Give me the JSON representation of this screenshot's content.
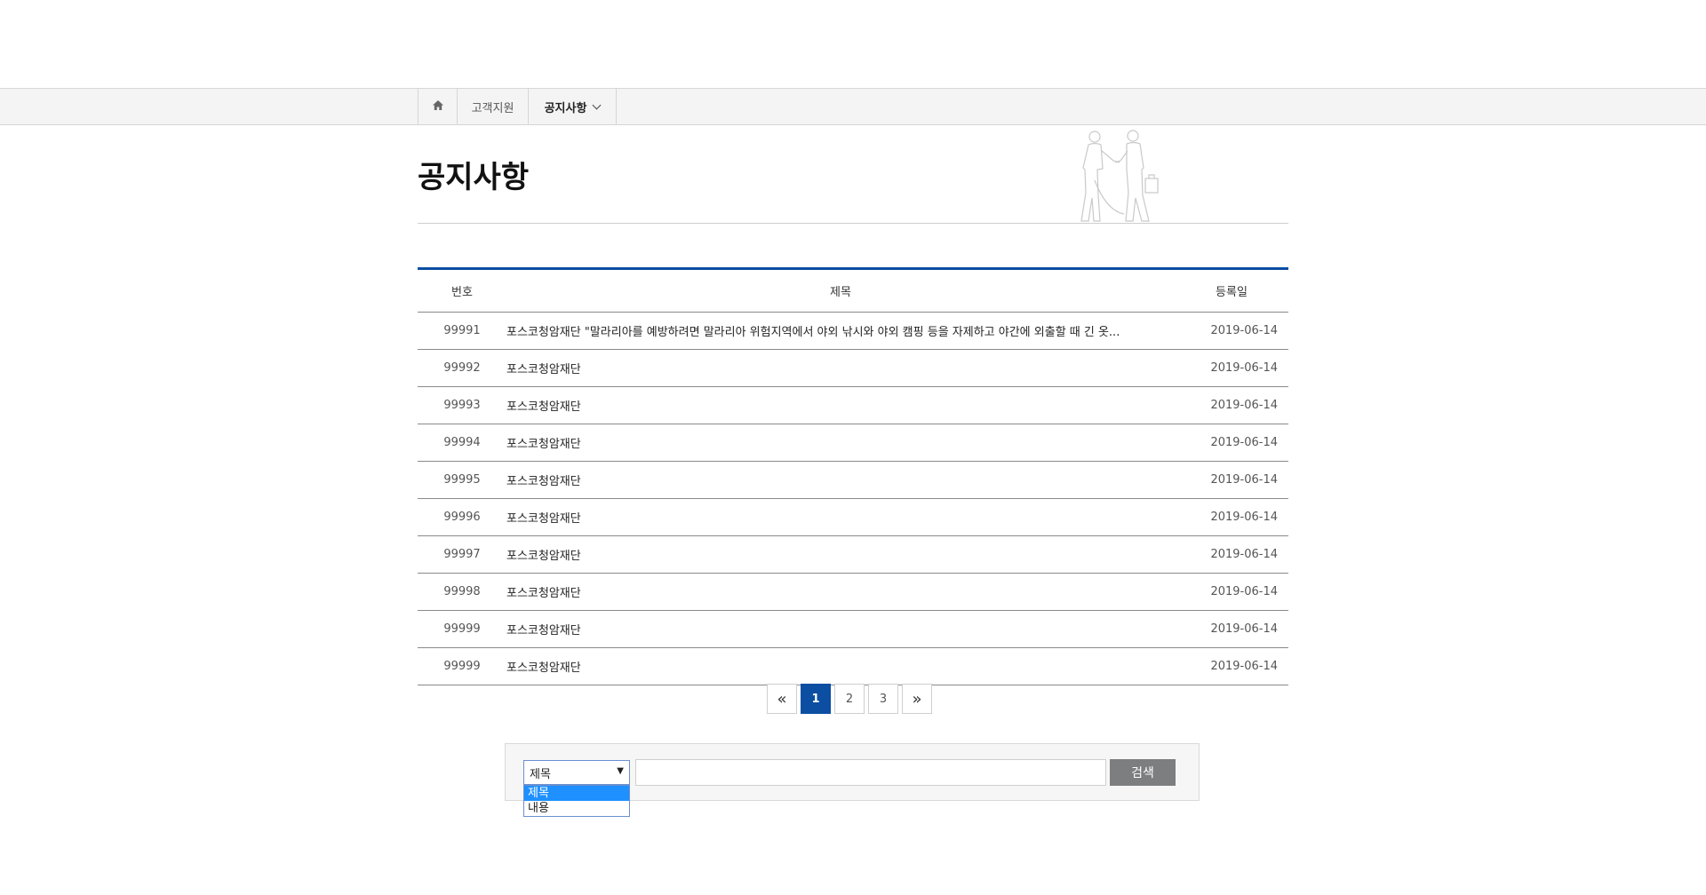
{
  "breadcrumb": {
    "home_icon": "home-icon",
    "items": [
      "고객지원",
      "공지사항"
    ]
  },
  "page": {
    "title": "공지사항"
  },
  "table": {
    "headers": {
      "number": "번호",
      "title": "제목",
      "date": "등록일"
    },
    "rows": [
      {
        "number": "99991",
        "title": "포스코청암재단 \"말라리아를 예방하려면 말라리아 위험지역에서 야외 낚시와 야외 캠핑 등을 자제하고 야간에 외출할 때 긴 옷...",
        "date": "2019-06-14"
      },
      {
        "number": "99992",
        "title": "포스코청암재단",
        "date": "2019-06-14"
      },
      {
        "number": "99993",
        "title": "포스코청암재단",
        "date": "2019-06-14"
      },
      {
        "number": "99994",
        "title": "포스코청암재단",
        "date": "2019-06-14"
      },
      {
        "number": "99995",
        "title": "포스코청암재단",
        "date": "2019-06-14"
      },
      {
        "number": "99996",
        "title": "포스코청암재단",
        "date": "2019-06-14"
      },
      {
        "number": "99997",
        "title": "포스코청암재단",
        "date": "2019-06-14"
      },
      {
        "number": "99998",
        "title": "포스코청암재단",
        "date": "2019-06-14"
      },
      {
        "number": "99999",
        "title": "포스코청암재단",
        "date": "2019-06-14"
      },
      {
        "number": "99999",
        "title": "포스코청암재단",
        "date": "2019-06-14"
      }
    ]
  },
  "pagination": {
    "first": "«",
    "pages": [
      "1",
      "2",
      "3"
    ],
    "current": "1",
    "last": "»"
  },
  "search": {
    "select_value": "제목",
    "options": [
      "제목",
      "내용"
    ],
    "input_value": "",
    "button_label": "검색"
  },
  "colors": {
    "accent": "#0b4ea2",
    "button": "#7d7e80",
    "option_highlight": "#1e90ff"
  }
}
